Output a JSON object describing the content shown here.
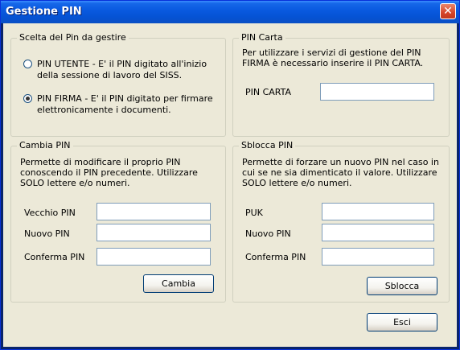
{
  "window": {
    "title": "Gestione PIN",
    "close_glyph": "✕"
  },
  "scelta": {
    "title": "Scelta del Pin da gestire",
    "options": [
      {
        "label": "PIN UTENTE - E' il PIN digitato all'inizio della sessione di lavoro del SISS.",
        "checked": false
      },
      {
        "label": "PIN FIRMA - E' il PIN digitato per firmare elettronicamente i documenti.",
        "checked": true
      }
    ]
  },
  "pin_carta": {
    "title": "PIN Carta",
    "description": "Per utilizzare i servizi di gestione del PIN FIRMA è necessario inserire il PIN CARTA.",
    "field_label": "PIN CARTA",
    "field_value": ""
  },
  "cambia": {
    "title": "Cambia PIN",
    "description": "Permette di modificare il proprio PIN conoscendo il PIN precedente. Utilizzare SOLO lettere e/o numeri.",
    "fields": [
      {
        "label": "Vecchio PIN",
        "value": ""
      },
      {
        "label": "Nuovo PIN",
        "value": ""
      },
      {
        "label": "Conferma PIN",
        "value": ""
      }
    ],
    "button": "Cambia"
  },
  "sblocca": {
    "title": "Sblocca PIN",
    "description": "Permette di forzare un nuovo PIN nel caso in cui se ne sia dimenticato il valore. Utilizzare SOLO lettere e/o numeri.",
    "fields": [
      {
        "label": "PUK",
        "value": ""
      },
      {
        "label": "Nuovo PIN",
        "value": ""
      },
      {
        "label": "Conferma PIN",
        "value": ""
      }
    ],
    "button": "Sblocca"
  },
  "footer": {
    "exit_button": "Esci"
  }
}
